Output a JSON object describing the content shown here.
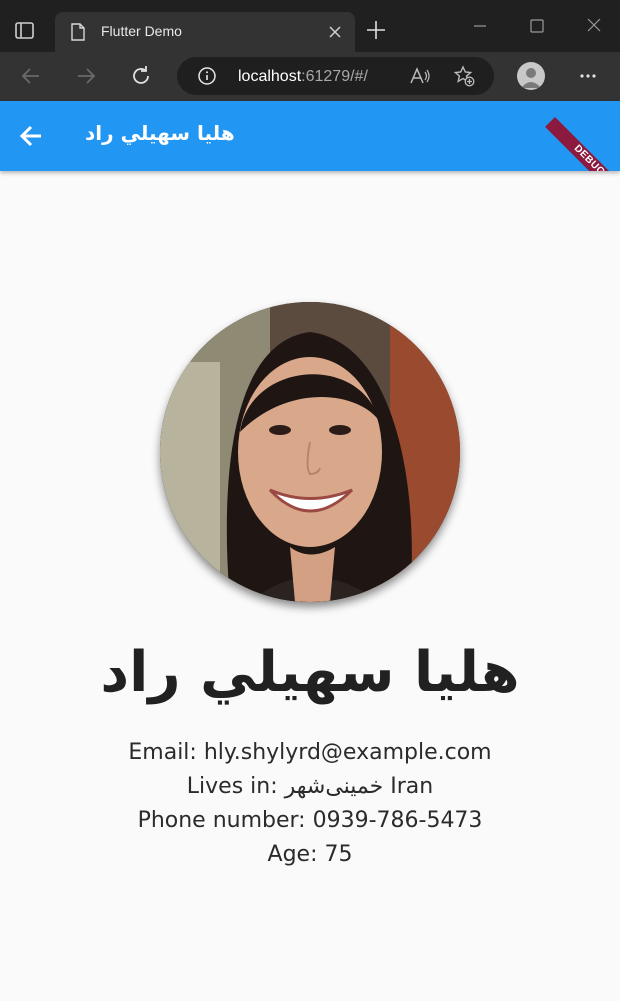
{
  "browser": {
    "tab_title": "Flutter Demo",
    "url_host": "localhost",
    "url_rest": ":61279/#/"
  },
  "app_bar": {
    "title": "هليا سهيلي راد",
    "debug_banner": "DEBUG",
    "color": "#2196f3"
  },
  "profile": {
    "name": "هليا سهيلي راد",
    "email": "Email: hly.shylyrd@example.com",
    "lives_in": "Lives in: خمینی‌شهر Iran",
    "phone": "Phone number: 0939-786-5473",
    "age": "Age: 75"
  }
}
